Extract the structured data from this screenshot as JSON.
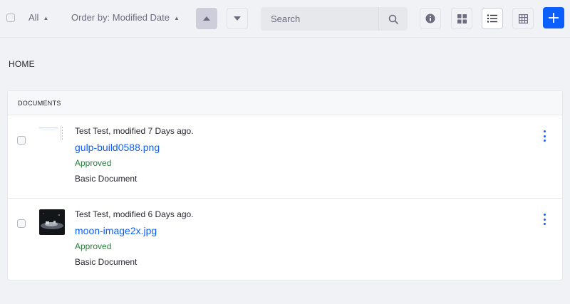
{
  "toolbar": {
    "filter_label": "All",
    "order_label": "Order by: Modified Date",
    "search_placeholder": "Search",
    "accent_color": "#0b5fff"
  },
  "breadcrumb": {
    "label": "HOME"
  },
  "documents": {
    "section_label": "DOCUMENTS",
    "items": [
      {
        "meta": "Test Test, modified 7 Days ago.",
        "title": "gulp-build0588.png",
        "status": "Approved",
        "type": "Basic Document",
        "thumbnail_icon": "image-thumbnail-icon"
      },
      {
        "meta": "Test Test, modified 6 Days ago.",
        "title": "moon-image2x.jpg",
        "status": "Approved",
        "type": "Basic Document",
        "thumbnail_icon": "image-thumbnail-icon"
      }
    ]
  }
}
